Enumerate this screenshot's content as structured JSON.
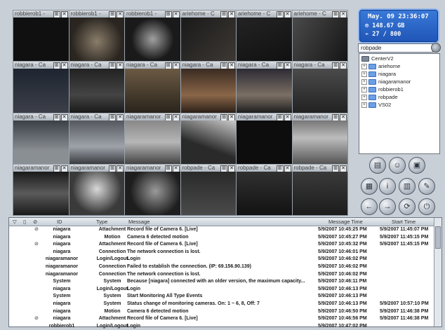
{
  "status": {
    "datetime": "May. 09 23:36:07",
    "disk": "148.67 GB",
    "count": "27 / 800"
  },
  "search": {
    "value": "robpade"
  },
  "tree": {
    "root": "CenterV2",
    "items": [
      "ariehome",
      "niagara",
      "niagaramanor",
      "robbierob1",
      "robpade",
      "VS02"
    ]
  },
  "cameras": [
    "robbierob1 -",
    "robbierob1 -",
    "robbierob1 -",
    "ariehome - C",
    "ariehome - C",
    "ariehome - C",
    "niagara - Ca",
    "niagara - Ca",
    "niagara - Ca",
    "niagara - Ca",
    "niagara - Ca",
    "niagara - Ca",
    "niagara - Ca",
    "niagara - Ca",
    "niagaramanor",
    "niagaramanor",
    "niagaramanor",
    "niagaramanor",
    "niagaramanor",
    "niagaramanor",
    "niagaramanor",
    "robpade - Ca",
    "robpade - Ca",
    "robpade - Ca"
  ],
  "log": {
    "columns": [
      "ID",
      "Type",
      "Message",
      "Message Time",
      "Start Time"
    ],
    "rows": [
      [
        "niagara",
        "Attachment",
        "Record file of Camera 6. [Live]",
        "5/9/2007 10:45:25 PM",
        "5/9/2007 11:45:07 PM"
      ],
      [
        "niagara",
        "Motion",
        "Camera 6 detected motion",
        "5/9/2007 10:45:27 PM",
        "5/9/2007 11:45:15 PM"
      ],
      [
        "niagara",
        "Attachment",
        "Record file of Camera 6. [Live]",
        "5/9/2007 10:45:32 PM",
        "5/9/2007 11:45:15 PM"
      ],
      [
        "niagara",
        "Connection",
        "The network connection is lost.",
        "5/9/2007 10:46:01 PM",
        ""
      ],
      [
        "niagaramanor",
        "Login/Logout",
        "Login",
        "5/9/2007 10:46:02 PM",
        ""
      ],
      [
        "niagaramanor",
        "Connection",
        "Failed to establish the connection. (IP: 69.156.90.139)",
        "5/9/2007 10:46:02 PM",
        ""
      ],
      [
        "niagaramanor",
        "Connection",
        "The network connection is lost.",
        "5/9/2007 10:46:02 PM",
        ""
      ],
      [
        "System",
        "System",
        "Because [niagara] connected with an older version, the maximum capacity...",
        "5/9/2007 10:46:11 PM",
        ""
      ],
      [
        "niagara",
        "Login/Logout",
        "Login",
        "5/9/2007 10:46:13 PM",
        ""
      ],
      [
        "System",
        "System",
        "Start Monitoring All Type Events",
        "5/9/2007 10:46:13 PM",
        ""
      ],
      [
        "niagara",
        "System",
        "Status change of monitoring cameras. On: 1 ~ 6, 8, Off: 7",
        "5/9/2007 10:46:13 PM",
        "5/9/2007 10:57:10 PM"
      ],
      [
        "niagara",
        "Motion",
        "Camera 6 detected motion",
        "5/9/2007 10:46:50 PM",
        "5/9/2007 11:46:38 PM"
      ],
      [
        "niagara",
        "Attachment",
        "Record file of Camera 6. [Live]",
        "5/9/2007 10:46:56 PM",
        "5/9/2007 11:46:38 PM"
      ],
      [
        "robbierob1",
        "Login/Logout",
        "Login",
        "5/9/2007 10:47:02 PM",
        ""
      ]
    ]
  }
}
